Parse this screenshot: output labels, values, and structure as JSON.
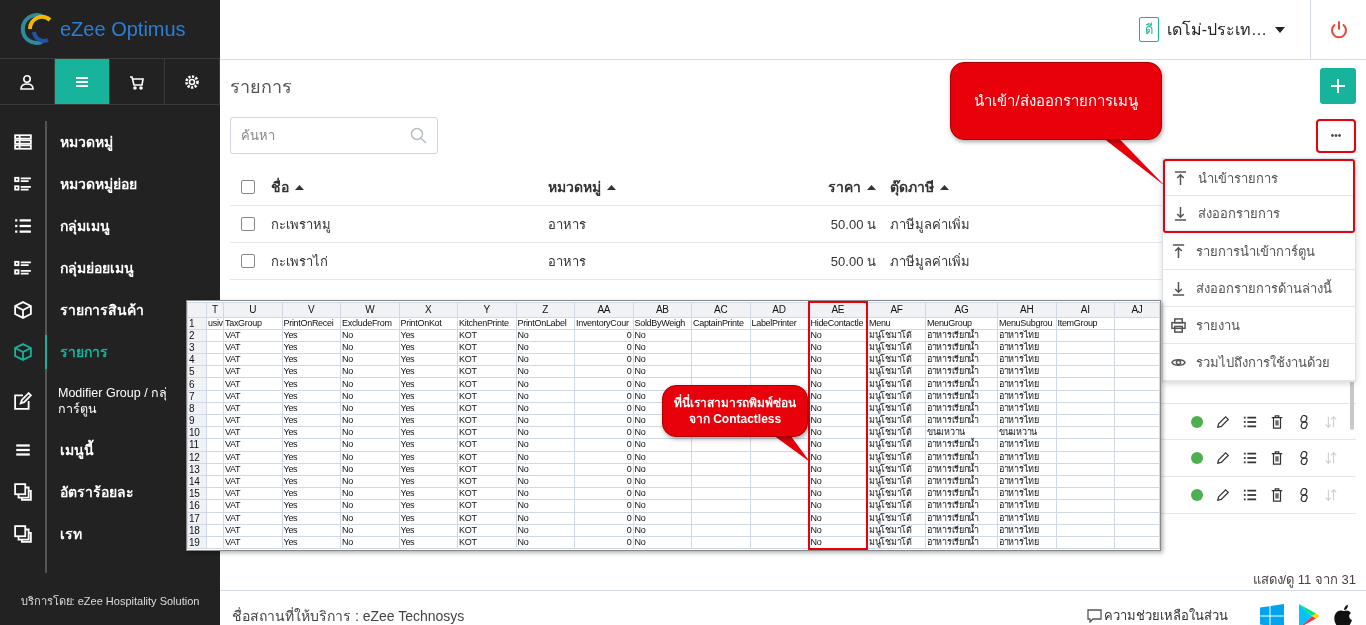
{
  "sidebar": {
    "logo": "eZee Optimus",
    "tabs": [
      {
        "selected": false
      },
      {
        "selected": true
      },
      {
        "selected": false
      },
      {
        "selected": false
      }
    ],
    "items": [
      {
        "label": "หมวดหมู่",
        "selected": false
      },
      {
        "label": "หมวดหมู่ย่อย",
        "selected": false
      },
      {
        "label": "กลุ่มเมนู",
        "selected": false
      },
      {
        "label": "กลุ่มย่อยเมนู",
        "selected": false
      },
      {
        "label": "รายการสินค้า",
        "selected": false
      },
      {
        "label": "รายการ",
        "selected": true
      },
      {
        "label": "Modifier Group / กลุ่ การ์ตูน",
        "selected": false
      },
      {
        "label": "เมนูนี้",
        "selected": false
      },
      {
        "label": "อัตราร้อยละ",
        "selected": false
      },
      {
        "label": "เรท",
        "selected": false
      }
    ],
    "footer": "บริการโดย: eZee Hospitality Solution"
  },
  "header": {
    "badge": "ดี",
    "property": "เดโม่-ประเท…"
  },
  "page": {
    "title": "รายการ",
    "search": {
      "placeholder": "ค้นหา"
    },
    "more_button": {
      "label": "•••",
      "highlighted": true
    }
  },
  "table": {
    "all_checked": false,
    "columns": [
      {
        "label": "ชื่อ"
      },
      {
        "label": "หมวดหมู่"
      },
      {
        "label": "ราคา"
      },
      {
        "label": "ตุ๊ดภาษี"
      }
    ],
    "rows": [
      {
        "cells": [
          "กะเพราหมู",
          "อาหาร",
          "50.00 น",
          "ภาษีมูลค่าเพิ่ม"
        ],
        "checked": false
      },
      {
        "cells": [
          "กะเพราไก่",
          "อาหาร",
          "50.00 น",
          "ภาษีมูลค่าเพิ่ม"
        ],
        "checked": false
      },
      {
        "active": true
      },
      {
        "active": true
      },
      {
        "active": true
      }
    ],
    "summary": "แสดง/ดู 11 จาก 31"
  },
  "menu": {
    "items": [
      {
        "label": "นำเข้ารายการ",
        "highlighted": true
      },
      {
        "label": "ส่งออกรายการ",
        "highlighted": true
      },
      {
        "label": "รายการนำเข้าการ์ตูน",
        "highlighted": false
      },
      {
        "label": "ส่งออกรายการด้านล่างนี้",
        "highlighted": false
      },
      {
        "label": "รายงาน",
        "highlighted": false
      },
      {
        "label": "รวมไปถึงการใช้งานด้วย",
        "highlighted": false
      }
    ]
  },
  "callouts": [
    {
      "text": "นำเข้า/ส่งออกรายการเมนู"
    },
    {
      "text": "ที่นี่เราสามารถพิมพ์ซ่อน\nจาก Contactless"
    }
  ],
  "spreadsheet": {
    "columns": [
      {
        "letter": "T",
        "highlighted": false
      },
      {
        "letter": "U",
        "highlighted": false
      },
      {
        "letter": "V",
        "highlighted": false
      },
      {
        "letter": "W",
        "highlighted": false
      },
      {
        "letter": "X",
        "highlighted": false
      },
      {
        "letter": "Y",
        "highlighted": false
      },
      {
        "letter": "Z",
        "highlighted": false
      },
      {
        "letter": "AA",
        "highlighted": false
      },
      {
        "letter": "AB",
        "highlighted": false
      },
      {
        "letter": "AC",
        "highlighted": false
      },
      {
        "letter": "AD",
        "highlighted": false
      },
      {
        "letter": "AE",
        "highlighted": true
      },
      {
        "letter": "AF",
        "highlighted": false
      },
      {
        "letter": "AG",
        "highlighted": false
      },
      {
        "letter": "AH",
        "highlighted": false
      },
      {
        "letter": "AI",
        "highlighted": false
      },
      {
        "letter": "AJ",
        "highlighted": false
      }
    ],
    "rows": [
      {
        "number": "1",
        "cells": {
          "T": "usiv",
          "U": "TaxGroup",
          "V": "PrintOnRecei",
          "W": "ExcludeFrom",
          "X": "PrintOnKot",
          "Y": "KitchenPrinte",
          "Z": "PrintOnLabel",
          "AA": "InventoryCour",
          "AB": "SoldByWeigh",
          "AC": "CaptainPrinte",
          "AD": "LabelPrinter",
          "AE": "HideContactle",
          "AF": "Menu",
          "AG": "MenuGroup",
          "AH": "MenuSubgrou",
          "AI": "ItemGroup"
        }
      },
      {
        "number": "2",
        "cells": {
          "U": "VAT",
          "V": "Yes",
          "W": "No",
          "X": "Yes",
          "Y": "KOT",
          "Z": "No",
          "AA": "0",
          "AB": "No",
          "AE": "No",
          "AF": "มนูโชมาโต้",
          "AG": "อาหารเรียกน้ำ",
          "AH": "อาหารไทย"
        }
      },
      {
        "number": "3",
        "cells": {
          "U": "VAT",
          "V": "Yes",
          "W": "No",
          "X": "Yes",
          "Y": "KOT",
          "Z": "No",
          "AA": "0",
          "AB": "No",
          "AE": "No",
          "AF": "มนูโชมาโต้",
          "AG": "อาหารเรียกน้ำ",
          "AH": "อาหารไทย"
        }
      },
      {
        "number": "4",
        "cells": {
          "U": "VAT",
          "V": "Yes",
          "W": "No",
          "X": "Yes",
          "Y": "KOT",
          "Z": "No",
          "AA": "0",
          "AB": "No",
          "AE": "No",
          "AF": "มนูโชมาโต้",
          "AG": "อาหารเรียกน้ำ",
          "AH": "อาหารไทย"
        }
      },
      {
        "number": "5",
        "cells": {
          "U": "VAT",
          "V": "Yes",
          "W": "No",
          "X": "Yes",
          "Y": "KOT",
          "Z": "No",
          "AA": "0",
          "AB": "No",
          "AE": "No",
          "AF": "มนูโชมาโต้",
          "AG": "อาหารเรียกน้ำ",
          "AH": "อาหารไทย"
        }
      },
      {
        "number": "6",
        "cells": {
          "U": "VAT",
          "V": "Yes",
          "W": "No",
          "X": "Yes",
          "Y": "KOT",
          "Z": "No",
          "AA": "0",
          "AB": "No",
          "AE": "No",
          "AF": "มนูโชมาโต้",
          "AG": "อาหารเรียกน้ำ",
          "AH": "อาหารไทย"
        }
      },
      {
        "number": "7",
        "cells": {
          "U": "VAT",
          "V": "Yes",
          "W": "No",
          "X": "Yes",
          "Y": "KOT",
          "Z": "No",
          "AA": "0",
          "AB": "No",
          "AE": "No",
          "AF": "มนูโชมาโต้",
          "AG": "อาหารเรียกน้ำ",
          "AH": "อาหารไทย"
        }
      },
      {
        "number": "8",
        "cells": {
          "U": "VAT",
          "V": "Yes",
          "W": "No",
          "X": "Yes",
          "Y": "KOT",
          "Z": "No",
          "AA": "0",
          "AB": "No",
          "AE": "No",
          "AF": "มนูโชมาโต้",
          "AG": "อาหารเรียกน้ำ",
          "AH": "อาหารไทย"
        }
      },
      {
        "number": "9",
        "cells": {
          "U": "VAT",
          "V": "Yes",
          "W": "No",
          "X": "Yes",
          "Y": "KOT",
          "Z": "No",
          "AA": "0",
          "AB": "No",
          "AE": "No",
          "AF": "มนูโชมาโต้",
          "AG": "อาหารเรียกน้ำ",
          "AH": "อาหารไทย"
        }
      },
      {
        "number": "10",
        "cells": {
          "U": "VAT",
          "V": "Yes",
          "W": "No",
          "X": "Yes",
          "Y": "KOT",
          "Z": "No",
          "AA": "0",
          "AB": "No",
          "AE": "No",
          "AF": "มนูโชมาโต้",
          "AG": "ขนมหวาน",
          "AH": "ขนมหวาน"
        }
      },
      {
        "number": "11",
        "cells": {
          "U": "VAT",
          "V": "Yes",
          "W": "No",
          "X": "Yes",
          "Y": "KOT",
          "Z": "No",
          "AA": "0",
          "AB": "No",
          "AE": "No",
          "AF": "มนูโชมาโต้",
          "AG": "อาหารเรียกน้ำ",
          "AH": "อาหารไทย"
        }
      },
      {
        "number": "12",
        "cells": {
          "U": "VAT",
          "V": "Yes",
          "W": "No",
          "X": "Yes",
          "Y": "KOT",
          "Z": "No",
          "AA": "0",
          "AB": "No",
          "AE": "No",
          "AF": "มนูโชมาโต้",
          "AG": "อาหารเรียกน้ำ",
          "AH": "อาหารไทย"
        }
      },
      {
        "number": "13",
        "cells": {
          "U": "VAT",
          "V": "Yes",
          "W": "No",
          "X": "Yes",
          "Y": "KOT",
          "Z": "No",
          "AA": "0",
          "AB": "No",
          "AE": "No",
          "AF": "มนูโชมาโต้",
          "AG": "อาหารเรียกน้ำ",
          "AH": "อาหารไทย"
        }
      },
      {
        "number": "14",
        "cells": {
          "U": "VAT",
          "V": "Yes",
          "W": "No",
          "X": "Yes",
          "Y": "KOT",
          "Z": "No",
          "AA": "0",
          "AB": "No",
          "AE": "No",
          "AF": "มนูโชมาโต้",
          "AG": "อาหารเรียกน้ำ",
          "AH": "อาหารไทย"
        }
      },
      {
        "number": "15",
        "cells": {
          "U": "VAT",
          "V": "Yes",
          "W": "No",
          "X": "Yes",
          "Y": "KOT",
          "Z": "No",
          "AA": "0",
          "AB": "No",
          "AE": "No",
          "AF": "มนูโชมาโต้",
          "AG": "อาหารเรียกน้ำ",
          "AH": "อาหารไทย"
        }
      },
      {
        "number": "16",
        "cells": {
          "U": "VAT",
          "V": "Yes",
          "W": "No",
          "X": "Yes",
          "Y": "KOT",
          "Z": "No",
          "AA": "0",
          "AB": "No",
          "AE": "No",
          "AF": "มนูโชมาโต้",
          "AG": "อาหารเรียกน้ำ",
          "AH": "อาหารไทย"
        }
      },
      {
        "number": "17",
        "cells": {
          "U": "VAT",
          "V": "Yes",
          "W": "No",
          "X": "Yes",
          "Y": "KOT",
          "Z": "No",
          "AA": "0",
          "AB": "No",
          "AE": "No",
          "AF": "มนูโชมาโต้",
          "AG": "อาหารเรียกน้ำ",
          "AH": "อาหารไทย"
        }
      },
      {
        "number": "18",
        "cells": {
          "U": "VAT",
          "V": "Yes",
          "W": "No",
          "X": "Yes",
          "Y": "KOT",
          "Z": "No",
          "AA": "0",
          "AB": "No",
          "AE": "No",
          "AF": "มนูโชมาโต้",
          "AG": "อาหารเรียกน้ำ",
          "AH": "อาหารไทย"
        }
      },
      {
        "number": "19",
        "cells": {
          "U": "VAT",
          "V": "Yes",
          "W": "No",
          "X": "Yes",
          "Y": "KOT",
          "Z": "No",
          "AA": "0",
          "AB": "No",
          "AE": "No",
          "AF": "มนูโชมาโต้",
          "AG": "อาหารเรียกน้ำ",
          "AH": "อาหารไทย"
        }
      }
    ]
  },
  "footer": {
    "location": "ชื่อสถานที่ให้บริการ : eZee Technosys",
    "help": "ความช่วยเหลือในส่วน"
  }
}
